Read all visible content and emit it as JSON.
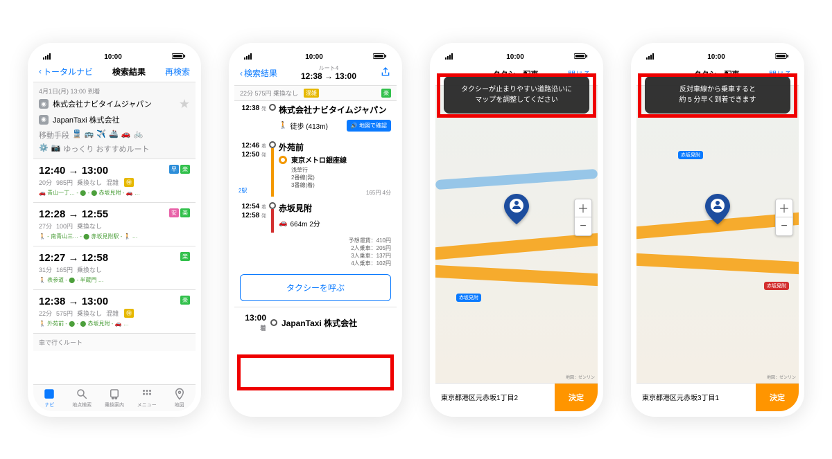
{
  "status": {
    "time": "10:00"
  },
  "p1": {
    "nav": {
      "back": "トータルナビ",
      "title": "検索結果",
      "right": "再検索"
    },
    "meta": "4月1日(月) 13:00 到着",
    "from": "株式会社ナビタイムジャパン",
    "to": "JapanTaxi 株式会社",
    "modes_label": "移動手段",
    "options_label": "ゆっくり おすすめルート",
    "car_route": "車で行くルート",
    "results": [
      {
        "time": "12:40 → 13:00",
        "dur": "20分",
        "fare": "985円",
        "transfer": "乗換なし",
        "cong": "混雑",
        "path": "🚗 青山一丁… - ⬤ - ⬤ 赤坂見附 - 🚗 …",
        "badges": [
          "早",
          "楽"
        ]
      },
      {
        "time": "12:28 → 12:55",
        "dur": "27分",
        "fare": "100円",
        "transfer": "乗換なし",
        "cong": "",
        "path": "🚶 - 南青山三… - ⬤ 赤坂見附駅 - 🚶 …",
        "badges": [
          "安",
          "楽"
        ]
      },
      {
        "time": "12:27 → 12:58",
        "dur": "31分",
        "fare": "165円",
        "transfer": "乗換なし",
        "cong": "",
        "path": "🚶 表参道 - ⬤ - 半蔵門 …",
        "badges": [
          "楽"
        ]
      },
      {
        "time": "12:38 → 13:00",
        "dur": "22分",
        "fare": "575円",
        "transfer": "乗換なし",
        "cong": "混雑",
        "path": "🚶 外苑前 - ⬤ - ⬤ 赤坂見附 - 🚗 …",
        "badges": [
          "楽"
        ]
      }
    ],
    "tabs": [
      "ナビ",
      "地点検索",
      "乗換案内",
      "メニュー",
      "地図"
    ]
  },
  "p2": {
    "nav": {
      "back": "検索結果",
      "route_no": "ルート4",
      "title": "12:38 → 13:00"
    },
    "meta": "22分 575円 乗換なし",
    "cong": "混雑",
    "dep_time": "12:38",
    "dep_suffix": "発",
    "dep_name": "株式会社ナビタイムジャパン",
    "walk": "徒歩 (413m)",
    "map_btn": "地図で確認",
    "s1_arr": "12:46",
    "s1_dep": "12:50",
    "s1_suffix_a": "着",
    "s1_suffix_d": "発",
    "s1_name": "外苑前",
    "line": "東京メトロ銀座線",
    "dest": "浅草行",
    "plat_dep": "2番線(発)",
    "plat_arr": "3番線(着)",
    "stops": "2駅",
    "fare": "165円 4分",
    "s2_arr": "12:54",
    "s2_dep": "12:58",
    "s2_name": "赤坂見附",
    "car": "664m 2分",
    "est_fare_label": "予想運賃：",
    "est_fare": "410円",
    "fare_2": "2人乗車：205円",
    "fare_3": "3人乗車：137円",
    "fare_4": "4人乗車：102円",
    "call_taxi": "タクシーを呼ぶ",
    "arr_time": "13:00",
    "arr_suffix": "着",
    "arr_name": "JapanTaxi 株式会社"
  },
  "p3": {
    "header": "タクシー配車",
    "close": "閉じる",
    "toast_l1": "タクシーが止まりやすい道路沿いに",
    "toast_l2": "マップを調整してください",
    "poi": "赤坂見附",
    "attrib": "地図：ゼンリン",
    "addr": "東京都港区元赤坂1丁目2",
    "confirm": "決定",
    "zoom_in": "＋",
    "zoom_out": "−"
  },
  "p4": {
    "header": "タクシー配車",
    "close": "閉じる",
    "toast_l1": "反対車線から乗車すると",
    "toast_l2": "約 5 分早く到着できます",
    "poi": "赤坂見附",
    "attrib": "地図：ゼンリン",
    "addr": "東京都港区元赤坂3丁目1",
    "confirm": "決定",
    "zoom_in": "＋",
    "zoom_out": "−"
  }
}
